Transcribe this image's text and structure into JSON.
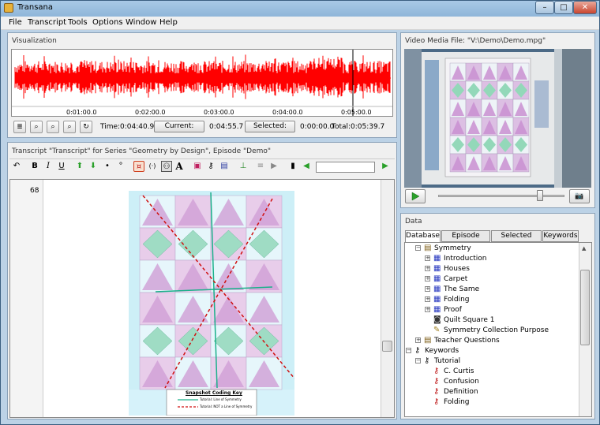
{
  "app": {
    "title": "Transana"
  },
  "window_controls": {
    "minimize": "–",
    "maximize": "□",
    "close": "✕"
  },
  "menu": [
    "File",
    "Transcript",
    "Tools",
    "Options",
    "Window",
    "Help"
  ],
  "visualization": {
    "title": "Visualization",
    "ticks": [
      "0:01:00.0",
      "0:02:00.0",
      "0:03:00.0",
      "0:04:00.0",
      "0:05:00.0"
    ],
    "time_label": "Time:",
    "time_value": "0:04:40.9",
    "current_label": "Current:",
    "current_value": "0:04:55.7",
    "selected_label": "Selected:",
    "selected_value": "0:00:00.0",
    "total_label": "Total:",
    "total_value": "0:05:39.7",
    "wave_color": "#ff0000"
  },
  "video": {
    "title": "Video Media File: \"V:\\Demo\\Demo.mpg\""
  },
  "transcript": {
    "title": "Transcript \"Transcript\" for Series \"Geometry by Design\", Episode \"Demo\"",
    "line_number": "68",
    "search_value": "",
    "legend_title": "Snapshot Coding Key",
    "legend_line1": "Tutorial: Line of Symmetry",
    "legend_line2": "Tutorial: NOT a Line of Symmetry"
  },
  "data": {
    "title": "Data",
    "tabs": [
      "Database",
      "Episode Items",
      "Selected Items",
      "Keywords"
    ],
    "active_tab": "Database",
    "tree": [
      {
        "label": "Symmetry",
        "level": 1,
        "icon": "collection",
        "exp": "-"
      },
      {
        "label": "Introduction",
        "level": 2,
        "icon": "clip",
        "exp": "+"
      },
      {
        "label": "Houses",
        "level": 2,
        "icon": "clip",
        "exp": "+"
      },
      {
        "label": "Carpet",
        "level": 2,
        "icon": "clip",
        "exp": "+"
      },
      {
        "label": "The Same",
        "level": 2,
        "icon": "clip",
        "exp": "+"
      },
      {
        "label": "Folding",
        "level": 2,
        "icon": "clip",
        "exp": "+"
      },
      {
        "label": "Proof",
        "level": 2,
        "icon": "clip",
        "exp": "+"
      },
      {
        "label": "Quilt Square 1",
        "level": 2,
        "icon": "snapshot",
        "exp": ""
      },
      {
        "label": "Symmetry Collection Purpose",
        "level": 2,
        "icon": "note",
        "exp": ""
      },
      {
        "label": "Teacher Questions",
        "level": 1,
        "icon": "collection",
        "exp": "+"
      },
      {
        "label": "Keywords",
        "level": 0,
        "icon": "keys",
        "exp": "-"
      },
      {
        "label": "Tutorial",
        "level": 1,
        "icon": "keygroup",
        "exp": "-"
      },
      {
        "label": "C. Curtis",
        "level": 2,
        "icon": "key",
        "exp": ""
      },
      {
        "label": "Confusion",
        "level": 2,
        "icon": "key",
        "exp": ""
      },
      {
        "label": "Definition",
        "level": 2,
        "icon": "key",
        "exp": ""
      },
      {
        "label": "Folding",
        "level": 2,
        "icon": "key",
        "exp": ""
      }
    ]
  }
}
